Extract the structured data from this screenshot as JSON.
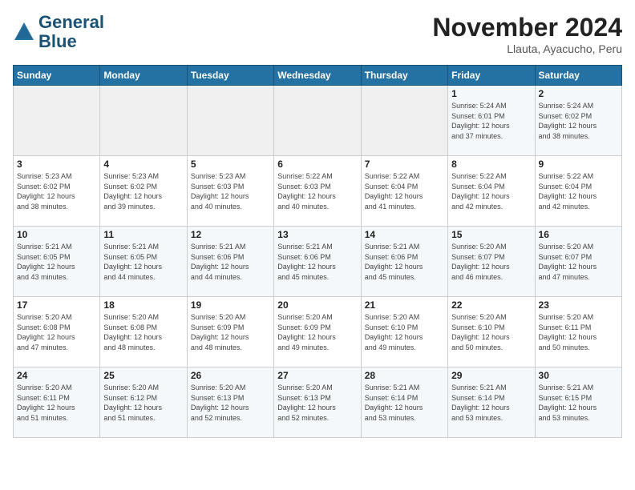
{
  "logo": {
    "line1": "General",
    "line2": "Blue"
  },
  "header": {
    "month_year": "November 2024",
    "location": "Llauta, Ayacucho, Peru"
  },
  "days_of_week": [
    "Sunday",
    "Monday",
    "Tuesday",
    "Wednesday",
    "Thursday",
    "Friday",
    "Saturday"
  ],
  "weeks": [
    [
      {
        "day": "",
        "info": ""
      },
      {
        "day": "",
        "info": ""
      },
      {
        "day": "",
        "info": ""
      },
      {
        "day": "",
        "info": ""
      },
      {
        "day": "",
        "info": ""
      },
      {
        "day": "1",
        "info": "Sunrise: 5:24 AM\nSunset: 6:01 PM\nDaylight: 12 hours\nand 37 minutes."
      },
      {
        "day": "2",
        "info": "Sunrise: 5:24 AM\nSunset: 6:02 PM\nDaylight: 12 hours\nand 38 minutes."
      }
    ],
    [
      {
        "day": "3",
        "info": "Sunrise: 5:23 AM\nSunset: 6:02 PM\nDaylight: 12 hours\nand 38 minutes."
      },
      {
        "day": "4",
        "info": "Sunrise: 5:23 AM\nSunset: 6:02 PM\nDaylight: 12 hours\nand 39 minutes."
      },
      {
        "day": "5",
        "info": "Sunrise: 5:23 AM\nSunset: 6:03 PM\nDaylight: 12 hours\nand 40 minutes."
      },
      {
        "day": "6",
        "info": "Sunrise: 5:22 AM\nSunset: 6:03 PM\nDaylight: 12 hours\nand 40 minutes."
      },
      {
        "day": "7",
        "info": "Sunrise: 5:22 AM\nSunset: 6:04 PM\nDaylight: 12 hours\nand 41 minutes."
      },
      {
        "day": "8",
        "info": "Sunrise: 5:22 AM\nSunset: 6:04 PM\nDaylight: 12 hours\nand 42 minutes."
      },
      {
        "day": "9",
        "info": "Sunrise: 5:22 AM\nSunset: 6:04 PM\nDaylight: 12 hours\nand 42 minutes."
      }
    ],
    [
      {
        "day": "10",
        "info": "Sunrise: 5:21 AM\nSunset: 6:05 PM\nDaylight: 12 hours\nand 43 minutes."
      },
      {
        "day": "11",
        "info": "Sunrise: 5:21 AM\nSunset: 6:05 PM\nDaylight: 12 hours\nand 44 minutes."
      },
      {
        "day": "12",
        "info": "Sunrise: 5:21 AM\nSunset: 6:06 PM\nDaylight: 12 hours\nand 44 minutes."
      },
      {
        "day": "13",
        "info": "Sunrise: 5:21 AM\nSunset: 6:06 PM\nDaylight: 12 hours\nand 45 minutes."
      },
      {
        "day": "14",
        "info": "Sunrise: 5:21 AM\nSunset: 6:06 PM\nDaylight: 12 hours\nand 45 minutes."
      },
      {
        "day": "15",
        "info": "Sunrise: 5:20 AM\nSunset: 6:07 PM\nDaylight: 12 hours\nand 46 minutes."
      },
      {
        "day": "16",
        "info": "Sunrise: 5:20 AM\nSunset: 6:07 PM\nDaylight: 12 hours\nand 47 minutes."
      }
    ],
    [
      {
        "day": "17",
        "info": "Sunrise: 5:20 AM\nSunset: 6:08 PM\nDaylight: 12 hours\nand 47 minutes."
      },
      {
        "day": "18",
        "info": "Sunrise: 5:20 AM\nSunset: 6:08 PM\nDaylight: 12 hours\nand 48 minutes."
      },
      {
        "day": "19",
        "info": "Sunrise: 5:20 AM\nSunset: 6:09 PM\nDaylight: 12 hours\nand 48 minutes."
      },
      {
        "day": "20",
        "info": "Sunrise: 5:20 AM\nSunset: 6:09 PM\nDaylight: 12 hours\nand 49 minutes."
      },
      {
        "day": "21",
        "info": "Sunrise: 5:20 AM\nSunset: 6:10 PM\nDaylight: 12 hours\nand 49 minutes."
      },
      {
        "day": "22",
        "info": "Sunrise: 5:20 AM\nSunset: 6:10 PM\nDaylight: 12 hours\nand 50 minutes."
      },
      {
        "day": "23",
        "info": "Sunrise: 5:20 AM\nSunset: 6:11 PM\nDaylight: 12 hours\nand 50 minutes."
      }
    ],
    [
      {
        "day": "24",
        "info": "Sunrise: 5:20 AM\nSunset: 6:11 PM\nDaylight: 12 hours\nand 51 minutes."
      },
      {
        "day": "25",
        "info": "Sunrise: 5:20 AM\nSunset: 6:12 PM\nDaylight: 12 hours\nand 51 minutes."
      },
      {
        "day": "26",
        "info": "Sunrise: 5:20 AM\nSunset: 6:13 PM\nDaylight: 12 hours\nand 52 minutes."
      },
      {
        "day": "27",
        "info": "Sunrise: 5:20 AM\nSunset: 6:13 PM\nDaylight: 12 hours\nand 52 minutes."
      },
      {
        "day": "28",
        "info": "Sunrise: 5:21 AM\nSunset: 6:14 PM\nDaylight: 12 hours\nand 53 minutes."
      },
      {
        "day": "29",
        "info": "Sunrise: 5:21 AM\nSunset: 6:14 PM\nDaylight: 12 hours\nand 53 minutes."
      },
      {
        "day": "30",
        "info": "Sunrise: 5:21 AM\nSunset: 6:15 PM\nDaylight: 12 hours\nand 53 minutes."
      }
    ]
  ]
}
